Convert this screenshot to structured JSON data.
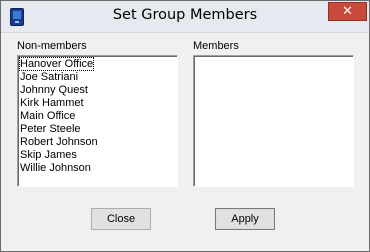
{
  "window": {
    "title": "Set Group Members",
    "close_glyph": "✕"
  },
  "nonmembers": {
    "label": "Non-members",
    "items": [
      "Hanover Office",
      "Joe Satriani",
      "Johnny Quest",
      "Kirk Hammet",
      "Main Office",
      "Peter Steele",
      "Robert Johnson",
      "Skip James",
      "Willie Johnson"
    ],
    "focused_index": 0
  },
  "members": {
    "label": "Members",
    "items": []
  },
  "buttons": {
    "close": "Close",
    "apply": "Apply"
  }
}
